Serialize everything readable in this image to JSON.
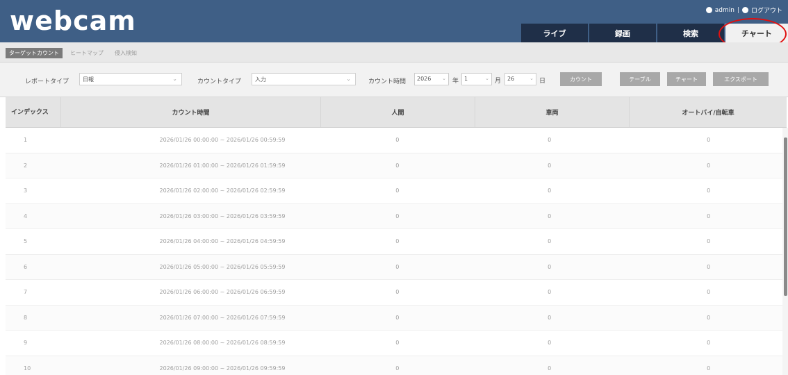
{
  "app": {
    "logo": "webcam"
  },
  "userbar": {
    "user": "admin",
    "separator": "|",
    "logout": "ログアウト"
  },
  "nav": {
    "tabs": [
      {
        "label": "ライブ"
      },
      {
        "label": "録画"
      },
      {
        "label": "検索"
      },
      {
        "label": "チャート",
        "active": true
      }
    ]
  },
  "subtabs": [
    {
      "label": "ターゲットカウント",
      "active": true
    },
    {
      "label": "ヒートマップ"
    },
    {
      "label": "侵入検知"
    }
  ],
  "filters": {
    "report_type_label": "レポートタイプ",
    "report_type_value": "日報",
    "count_type_label": "カウントタイプ",
    "count_type_value": "入力",
    "count_time_label": "カウント時間",
    "year_value": "2026",
    "year_unit": "年",
    "month_value": "1",
    "month_unit": "月",
    "day_value": "26",
    "day_unit": "日",
    "buttons": {
      "count": "カウント",
      "table": "テーブル",
      "chart": "チャート",
      "export": "エクスポート"
    }
  },
  "table": {
    "headers": [
      "インデックス",
      "カウント時間",
      "人間",
      "車両",
      "オートバイ/自転車"
    ],
    "rows": [
      [
        "1",
        "2026/01/26 00:00:00 ~ 2026/01/26 00:59:59",
        "0",
        "0",
        "0"
      ],
      [
        "2",
        "2026/01/26 01:00:00 ~ 2026/01/26 01:59:59",
        "0",
        "0",
        "0"
      ],
      [
        "3",
        "2026/01/26 02:00:00 ~ 2026/01/26 02:59:59",
        "0",
        "0",
        "0"
      ],
      [
        "4",
        "2026/01/26 03:00:00 ~ 2026/01/26 03:59:59",
        "0",
        "0",
        "0"
      ],
      [
        "5",
        "2026/01/26 04:00:00 ~ 2026/01/26 04:59:59",
        "0",
        "0",
        "0"
      ],
      [
        "6",
        "2026/01/26 05:00:00 ~ 2026/01/26 05:59:59",
        "0",
        "0",
        "0"
      ],
      [
        "7",
        "2026/01/26 06:00:00 ~ 2026/01/26 06:59:59",
        "0",
        "0",
        "0"
      ],
      [
        "8",
        "2026/01/26 07:00:00 ~ 2026/01/26 07:59:59",
        "0",
        "0",
        "0"
      ],
      [
        "9",
        "2026/01/26 08:00:00 ~ 2026/01/26 08:59:59",
        "0",
        "0",
        "0"
      ],
      [
        "10",
        "2026/01/26 09:00:00 ~ 2026/01/26 09:59:59",
        "0",
        "0",
        "0"
      ]
    ]
  },
  "colors": {
    "header_bg": "#3f5f86",
    "nav_tab_bg": "#1f2f48",
    "highlight": "#e01010"
  }
}
